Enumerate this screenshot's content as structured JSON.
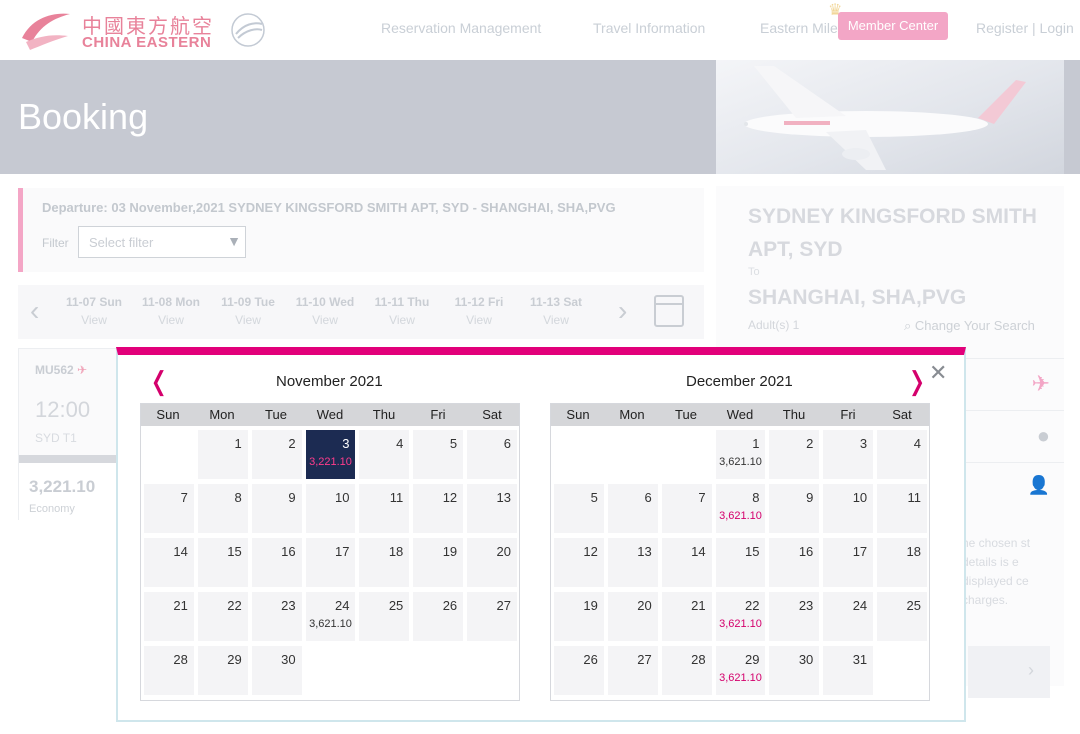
{
  "header": {
    "logo_cn": "中國東方航空",
    "logo_en": "CHINA EASTERN",
    "nav": [
      "Reservation Management",
      "Travel Information",
      "Eastern Miles"
    ],
    "member_center": "Member Center",
    "auth": "Register | Login"
  },
  "banner": {
    "title": "Booking"
  },
  "flight_search": {
    "departure": "Departure: 03 November,2021 SYDNEY KINGSFORD SMITH APT, SYD - SHANGHAI, SHA,PVG",
    "filter_label": "Filter",
    "filter_placeholder": "Select filter",
    "dates": [
      {
        "label": "11-07 Sun",
        "action": "View"
      },
      {
        "label": "11-08 Mon",
        "action": "View"
      },
      {
        "label": "11-09 Tue",
        "action": "View"
      },
      {
        "label": "11-10 Wed",
        "action": "View"
      },
      {
        "label": "11-11 Thu",
        "action": "View"
      },
      {
        "label": "11-12 Fri",
        "action": "View"
      },
      {
        "label": "11-13 Sat",
        "action": "View"
      }
    ]
  },
  "flight": {
    "number": "MU562",
    "time": "12:00",
    "airport": "SYD T1",
    "price": "3,221.10",
    "cabin": "Economy"
  },
  "summary": {
    "from": "SYDNEY KINGSFORD SMITH APT, SYD",
    "to_label": "To",
    "to": "SHANGHAI, SHA,PVG",
    "passengers": "Adult(s) 1",
    "change_search": "Change Your Search",
    "note": "he chosen st details is e displayed ce charges."
  },
  "calendar": {
    "weekdays": [
      "Sun",
      "Mon",
      "Tue",
      "Wed",
      "Thu",
      "Fri",
      "Sat"
    ],
    "months": [
      {
        "title": "November 2021",
        "weeks": [
          [
            {
              "d": ""
            },
            {
              "d": "1"
            },
            {
              "d": "2"
            },
            {
              "d": "3",
              "p": "3,221.10",
              "sel": true
            },
            {
              "d": "4"
            },
            {
              "d": "5"
            },
            {
              "d": "6"
            }
          ],
          [
            {
              "d": "7"
            },
            {
              "d": "8"
            },
            {
              "d": "9"
            },
            {
              "d": "10"
            },
            {
              "d": "11"
            },
            {
              "d": "12"
            },
            {
              "d": "13"
            }
          ],
          [
            {
              "d": "14"
            },
            {
              "d": "15"
            },
            {
              "d": "16"
            },
            {
              "d": "17"
            },
            {
              "d": "18"
            },
            {
              "d": "19"
            },
            {
              "d": "20"
            }
          ],
          [
            {
              "d": "21"
            },
            {
              "d": "22"
            },
            {
              "d": "23"
            },
            {
              "d": "24",
              "p": "3,621.10"
            },
            {
              "d": "25"
            },
            {
              "d": "26"
            },
            {
              "d": "27"
            }
          ],
          [
            {
              "d": "28"
            },
            {
              "d": "29"
            },
            {
              "d": "30"
            },
            {
              "d": ""
            },
            {
              "d": ""
            },
            {
              "d": ""
            },
            {
              "d": ""
            }
          ]
        ]
      },
      {
        "title": "December 2021",
        "weeks": [
          [
            {
              "d": ""
            },
            {
              "d": ""
            },
            {
              "d": ""
            },
            {
              "d": "1",
              "p": "3,621.10"
            },
            {
              "d": "2"
            },
            {
              "d": "3"
            },
            {
              "d": "4"
            }
          ],
          [
            {
              "d": "5"
            },
            {
              "d": "6"
            },
            {
              "d": "7"
            },
            {
              "d": "8",
              "p": "3,621.10",
              "pink": true
            },
            {
              "d": "9"
            },
            {
              "d": "10"
            },
            {
              "d": "11"
            }
          ],
          [
            {
              "d": "12"
            },
            {
              "d": "13"
            },
            {
              "d": "14"
            },
            {
              "d": "15"
            },
            {
              "d": "16"
            },
            {
              "d": "17"
            },
            {
              "d": "18"
            }
          ],
          [
            {
              "d": "19"
            },
            {
              "d": "20"
            },
            {
              "d": "21"
            },
            {
              "d": "22",
              "p": "3,621.10",
              "pink": true
            },
            {
              "d": "23"
            },
            {
              "d": "24"
            },
            {
              "d": "25"
            }
          ],
          [
            {
              "d": "26"
            },
            {
              "d": "27"
            },
            {
              "d": "28"
            },
            {
              "d": "29",
              "p": "3,621.10",
              "pink": true
            },
            {
              "d": "30"
            },
            {
              "d": "31"
            },
            {
              "d": ""
            }
          ]
        ]
      }
    ],
    "close_glyph": "✕",
    "prev_glyph": "❬",
    "next_glyph": "❭"
  },
  "colors": {
    "accent": "#e2007a",
    "selected_day": "#1c2b52",
    "price_pink": "#d4006c",
    "banner": "#c6c9d2",
    "member_btn": "#f3a6c6"
  }
}
